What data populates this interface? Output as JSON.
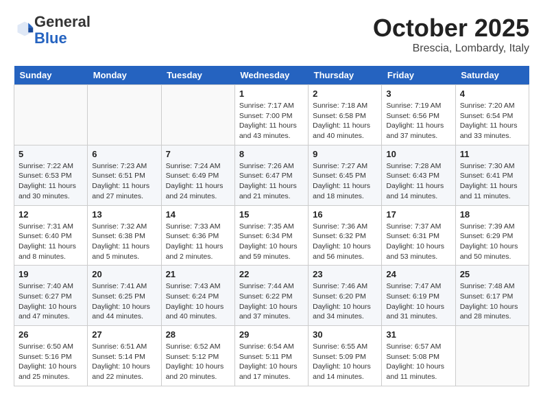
{
  "header": {
    "logo_general": "General",
    "logo_blue": "Blue",
    "month": "October 2025",
    "location": "Brescia, Lombardy, Italy"
  },
  "weekdays": [
    "Sunday",
    "Monday",
    "Tuesday",
    "Wednesday",
    "Thursday",
    "Friday",
    "Saturday"
  ],
  "weeks": [
    [
      {
        "day": "",
        "info": ""
      },
      {
        "day": "",
        "info": ""
      },
      {
        "day": "",
        "info": ""
      },
      {
        "day": "1",
        "info": "Sunrise: 7:17 AM\nSunset: 7:00 PM\nDaylight: 11 hours and 43 minutes."
      },
      {
        "day": "2",
        "info": "Sunrise: 7:18 AM\nSunset: 6:58 PM\nDaylight: 11 hours and 40 minutes."
      },
      {
        "day": "3",
        "info": "Sunrise: 7:19 AM\nSunset: 6:56 PM\nDaylight: 11 hours and 37 minutes."
      },
      {
        "day": "4",
        "info": "Sunrise: 7:20 AM\nSunset: 6:54 PM\nDaylight: 11 hours and 33 minutes."
      }
    ],
    [
      {
        "day": "5",
        "info": "Sunrise: 7:22 AM\nSunset: 6:53 PM\nDaylight: 11 hours and 30 minutes."
      },
      {
        "day": "6",
        "info": "Sunrise: 7:23 AM\nSunset: 6:51 PM\nDaylight: 11 hours and 27 minutes."
      },
      {
        "day": "7",
        "info": "Sunrise: 7:24 AM\nSunset: 6:49 PM\nDaylight: 11 hours and 24 minutes."
      },
      {
        "day": "8",
        "info": "Sunrise: 7:26 AM\nSunset: 6:47 PM\nDaylight: 11 hours and 21 minutes."
      },
      {
        "day": "9",
        "info": "Sunrise: 7:27 AM\nSunset: 6:45 PM\nDaylight: 11 hours and 18 minutes."
      },
      {
        "day": "10",
        "info": "Sunrise: 7:28 AM\nSunset: 6:43 PM\nDaylight: 11 hours and 14 minutes."
      },
      {
        "day": "11",
        "info": "Sunrise: 7:30 AM\nSunset: 6:41 PM\nDaylight: 11 hours and 11 minutes."
      }
    ],
    [
      {
        "day": "12",
        "info": "Sunrise: 7:31 AM\nSunset: 6:40 PM\nDaylight: 11 hours and 8 minutes."
      },
      {
        "day": "13",
        "info": "Sunrise: 7:32 AM\nSunset: 6:38 PM\nDaylight: 11 hours and 5 minutes."
      },
      {
        "day": "14",
        "info": "Sunrise: 7:33 AM\nSunset: 6:36 PM\nDaylight: 11 hours and 2 minutes."
      },
      {
        "day": "15",
        "info": "Sunrise: 7:35 AM\nSunset: 6:34 PM\nDaylight: 10 hours and 59 minutes."
      },
      {
        "day": "16",
        "info": "Sunrise: 7:36 AM\nSunset: 6:32 PM\nDaylight: 10 hours and 56 minutes."
      },
      {
        "day": "17",
        "info": "Sunrise: 7:37 AM\nSunset: 6:31 PM\nDaylight: 10 hours and 53 minutes."
      },
      {
        "day": "18",
        "info": "Sunrise: 7:39 AM\nSunset: 6:29 PM\nDaylight: 10 hours and 50 minutes."
      }
    ],
    [
      {
        "day": "19",
        "info": "Sunrise: 7:40 AM\nSunset: 6:27 PM\nDaylight: 10 hours and 47 minutes."
      },
      {
        "day": "20",
        "info": "Sunrise: 7:41 AM\nSunset: 6:25 PM\nDaylight: 10 hours and 44 minutes."
      },
      {
        "day": "21",
        "info": "Sunrise: 7:43 AM\nSunset: 6:24 PM\nDaylight: 10 hours and 40 minutes."
      },
      {
        "day": "22",
        "info": "Sunrise: 7:44 AM\nSunset: 6:22 PM\nDaylight: 10 hours and 37 minutes."
      },
      {
        "day": "23",
        "info": "Sunrise: 7:46 AM\nSunset: 6:20 PM\nDaylight: 10 hours and 34 minutes."
      },
      {
        "day": "24",
        "info": "Sunrise: 7:47 AM\nSunset: 6:19 PM\nDaylight: 10 hours and 31 minutes."
      },
      {
        "day": "25",
        "info": "Sunrise: 7:48 AM\nSunset: 6:17 PM\nDaylight: 10 hours and 28 minutes."
      }
    ],
    [
      {
        "day": "26",
        "info": "Sunrise: 6:50 AM\nSunset: 5:16 PM\nDaylight: 10 hours and 25 minutes."
      },
      {
        "day": "27",
        "info": "Sunrise: 6:51 AM\nSunset: 5:14 PM\nDaylight: 10 hours and 22 minutes."
      },
      {
        "day": "28",
        "info": "Sunrise: 6:52 AM\nSunset: 5:12 PM\nDaylight: 10 hours and 20 minutes."
      },
      {
        "day": "29",
        "info": "Sunrise: 6:54 AM\nSunset: 5:11 PM\nDaylight: 10 hours and 17 minutes."
      },
      {
        "day": "30",
        "info": "Sunrise: 6:55 AM\nSunset: 5:09 PM\nDaylight: 10 hours and 14 minutes."
      },
      {
        "day": "31",
        "info": "Sunrise: 6:57 AM\nSunset: 5:08 PM\nDaylight: 10 hours and 11 minutes."
      },
      {
        "day": "",
        "info": ""
      }
    ]
  ]
}
